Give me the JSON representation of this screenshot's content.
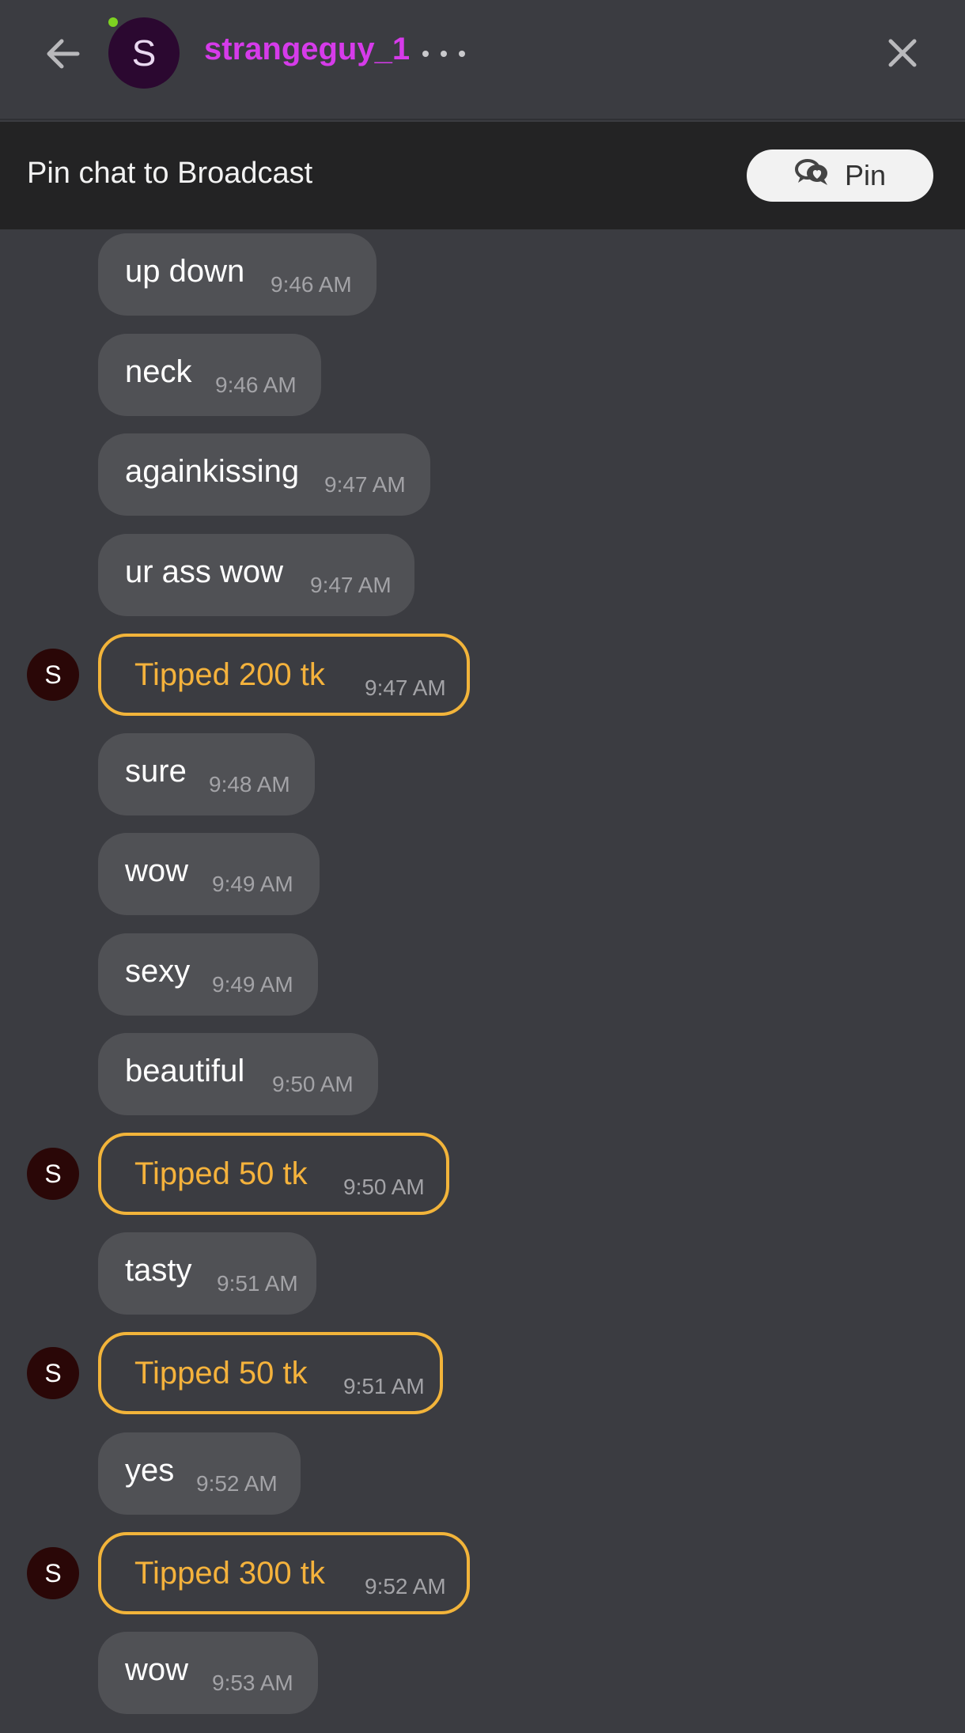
{
  "header": {
    "avatar_letter": "S",
    "username": "strangeguy_1"
  },
  "pinbar": {
    "text": "Pin chat to Broadcast",
    "button_label": "Pin"
  },
  "messages": [
    {
      "type": "text",
      "text": "up down",
      "time": "9:46 AM"
    },
    {
      "type": "text",
      "text": "neck",
      "time": "9:46 AM"
    },
    {
      "type": "text",
      "text": "againkissing",
      "time": "9:47 AM"
    },
    {
      "type": "text",
      "text": "ur ass wow",
      "time": "9:47 AM"
    },
    {
      "type": "tip",
      "text": "Tipped 200 tk",
      "time": "9:47 AM",
      "avatar": "S"
    },
    {
      "type": "text",
      "text": "sure",
      "time": "9:48 AM"
    },
    {
      "type": "text",
      "text": "wow",
      "time": "9:49 AM"
    },
    {
      "type": "text",
      "text": "sexy",
      "time": "9:49 AM"
    },
    {
      "type": "text",
      "text": "beautiful",
      "time": "9:50 AM"
    },
    {
      "type": "tip",
      "text": "Tipped 50 tk",
      "time": "9:50 AM",
      "avatar": "S"
    },
    {
      "type": "text",
      "text": "tasty",
      "time": "9:51 AM"
    },
    {
      "type": "tip",
      "text": "Tipped 50 tk",
      "time": "9:51 AM",
      "avatar": "S"
    },
    {
      "type": "text",
      "text": "yes",
      "time": "9:52 AM"
    },
    {
      "type": "tip",
      "text": "Tipped 300 tk",
      "time": "9:52 AM",
      "avatar": "S"
    },
    {
      "type": "text",
      "text": "wow",
      "time": "9:53 AM"
    }
  ]
}
